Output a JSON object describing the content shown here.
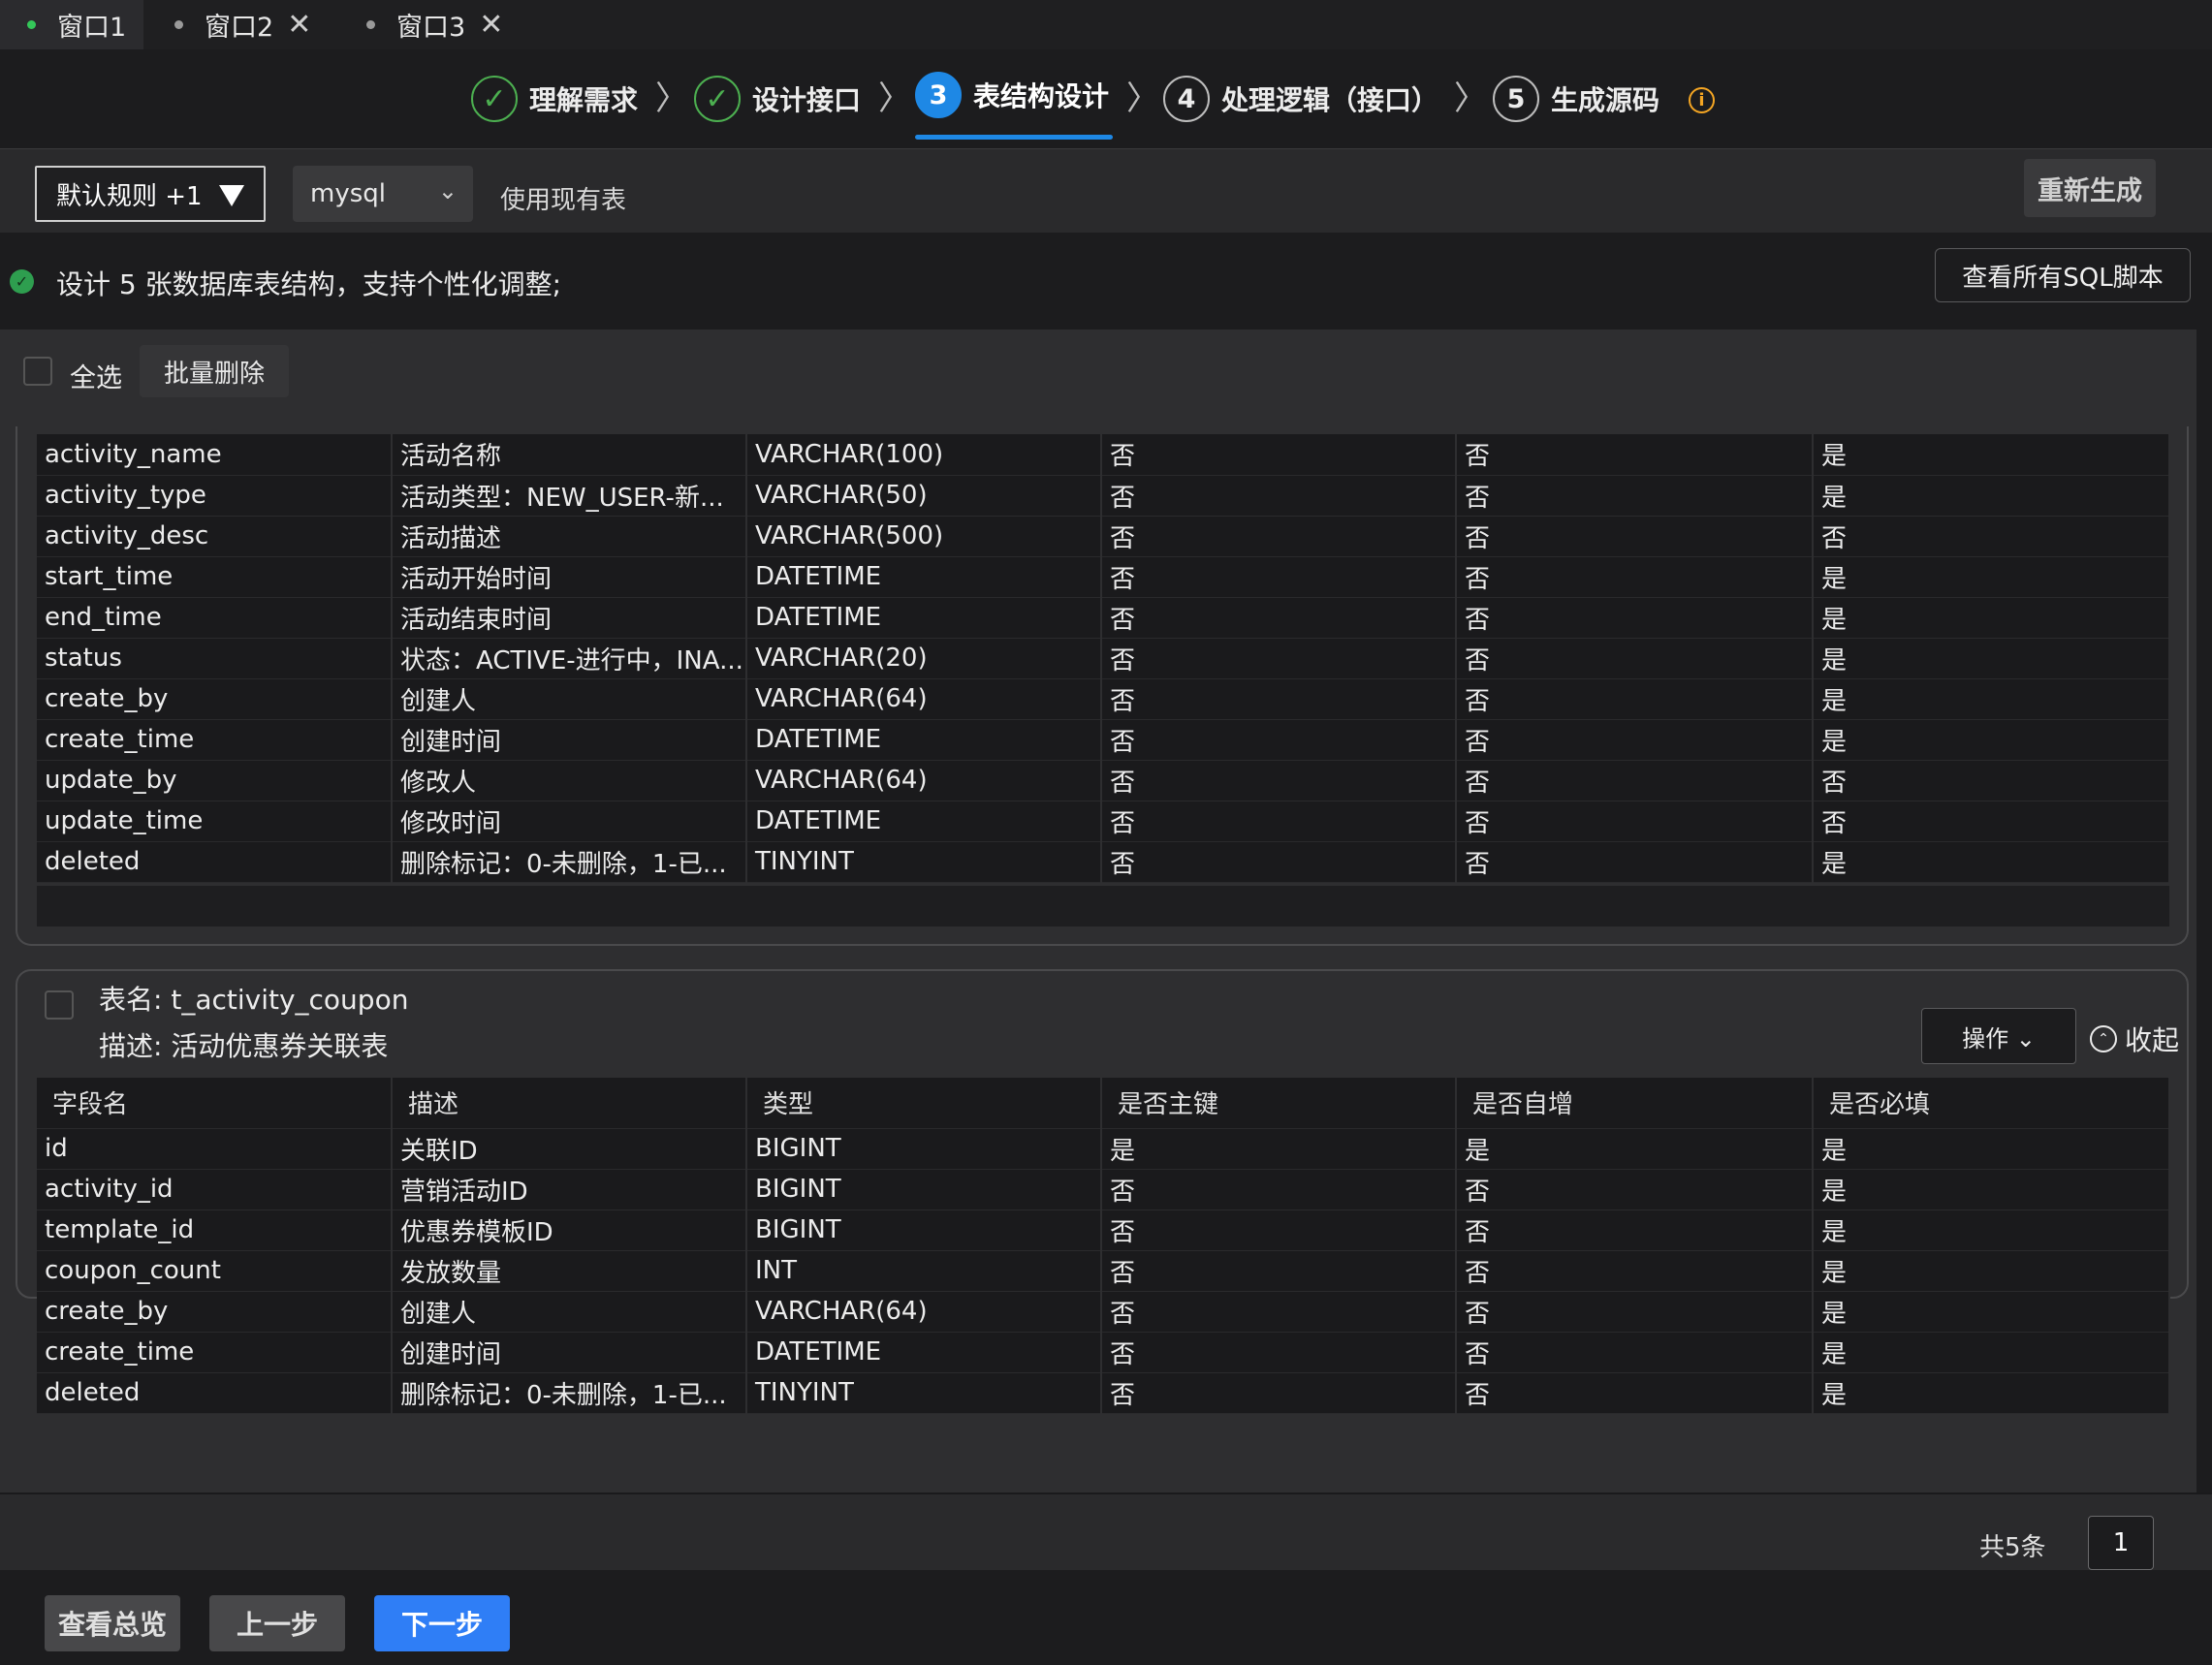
{
  "window_tabs": [
    {
      "label": "窗口1",
      "active": true,
      "closable": false
    },
    {
      "label": "窗口2",
      "active": false,
      "closable": true
    },
    {
      "label": "窗口3",
      "active": false,
      "closable": true
    }
  ],
  "close_glyph": "✕",
  "steps": [
    {
      "mark": "✓",
      "label": "理解需求",
      "state": "done"
    },
    {
      "mark": "✓",
      "label": "设计接口",
      "state": "done"
    },
    {
      "mark": "3",
      "label": "表结构设计",
      "state": "current"
    },
    {
      "mark": "4",
      "label": "处理逻辑（接口）",
      "state": "todo"
    },
    {
      "mark": "5",
      "label": "生成源码",
      "state": "todo"
    }
  ],
  "step_separator": "〉",
  "info_glyph": "i",
  "toolbar": {
    "rule_select": "默认规则 +1",
    "db_select": "mysql",
    "db_chevron": "⌄",
    "use_existing": "使用现有表",
    "regenerate": "重新生成"
  },
  "summary": {
    "ok_glyph": "✓",
    "text": "设计 5 张数据库表结构，支持个性化调整;",
    "view_sql": "查看所有SQL脚本"
  },
  "selection": {
    "select_all": "全选",
    "bulk_delete": "批量删除"
  },
  "columns": [
    "字段名",
    "描述",
    "类型",
    "是否主键",
    "是否自增",
    "是否必填"
  ],
  "table1": {
    "rows": [
      [
        "activity_name",
        "活动名称",
        "VARCHAR(100)",
        "否",
        "否",
        "是"
      ],
      [
        "activity_type",
        "活动类型：NEW_USER-新...",
        "VARCHAR(50)",
        "否",
        "否",
        "是"
      ],
      [
        "activity_desc",
        "活动描述",
        "VARCHAR(500)",
        "否",
        "否",
        "否"
      ],
      [
        "start_time",
        "活动开始时间",
        "DATETIME",
        "否",
        "否",
        "是"
      ],
      [
        "end_time",
        "活动结束时间",
        "DATETIME",
        "否",
        "否",
        "是"
      ],
      [
        "status",
        "状态：ACTIVE-进行中，INA...",
        "VARCHAR(20)",
        "否",
        "否",
        "是"
      ],
      [
        "create_by",
        "创建人",
        "VARCHAR(64)",
        "否",
        "否",
        "是"
      ],
      [
        "create_time",
        "创建时间",
        "DATETIME",
        "否",
        "否",
        "是"
      ],
      [
        "update_by",
        "修改人",
        "VARCHAR(64)",
        "否",
        "否",
        "否"
      ],
      [
        "update_time",
        "修改时间",
        "DATETIME",
        "否",
        "否",
        "否"
      ],
      [
        "deleted",
        "删除标记：0-未删除，1-已...",
        "TINYINT",
        "否",
        "否",
        "是"
      ]
    ]
  },
  "table2": {
    "title": "表名: t_activity_coupon",
    "desc": "描述: 活动优惠券关联表",
    "operation": "操作 ⌄",
    "collapse": "收起",
    "collapse_glyph": "⌃",
    "rows": [
      [
        "id",
        "关联ID",
        "BIGINT",
        "是",
        "是",
        "是"
      ],
      [
        "activity_id",
        "营销活动ID",
        "BIGINT",
        "否",
        "否",
        "是"
      ],
      [
        "template_id",
        "优惠券模板ID",
        "BIGINT",
        "否",
        "否",
        "是"
      ],
      [
        "coupon_count",
        "发放数量",
        "INT",
        "否",
        "否",
        "是"
      ],
      [
        "create_by",
        "创建人",
        "VARCHAR(64)",
        "否",
        "否",
        "是"
      ],
      [
        "create_time",
        "创建时间",
        "DATETIME",
        "否",
        "否",
        "是"
      ],
      [
        "deleted",
        "删除标记：0-未删除，1-已...",
        "TINYINT",
        "否",
        "否",
        "是"
      ]
    ]
  },
  "pagination": {
    "total": "共5条",
    "page": "1"
  },
  "actions": {
    "overview": "查看总览",
    "prev": "上一步",
    "next": "下一步"
  },
  "colors": {
    "accent": "#2f7ef6",
    "step_current": "#1e88e5",
    "step_done": "#4caf50",
    "info": "#f5a623",
    "ok": "#2e9e4f"
  }
}
